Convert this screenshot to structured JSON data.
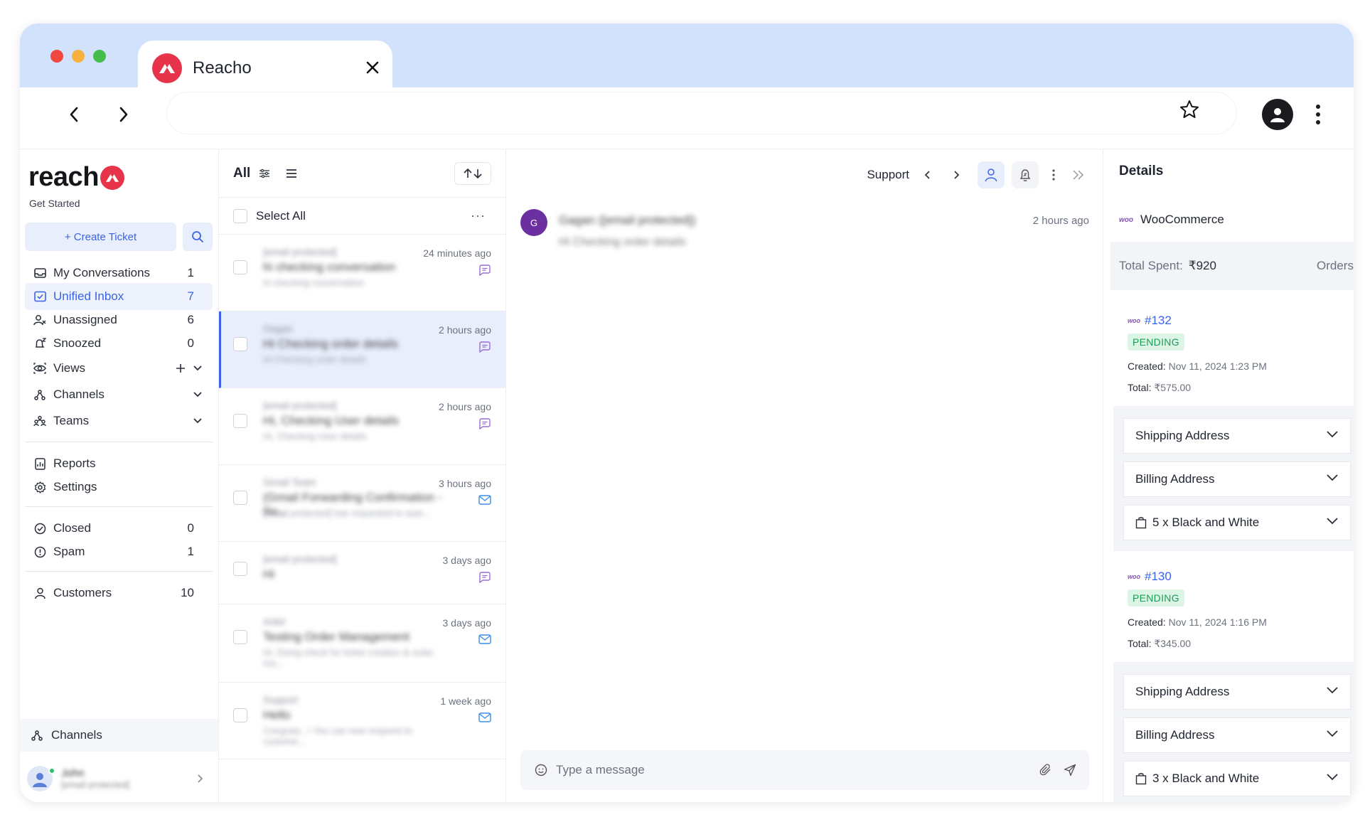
{
  "browser": {
    "tab_title": "Reacho",
    "url": ""
  },
  "colors": {
    "accent": "#3b63e5",
    "brand": "#e8344a",
    "chrome": "#d3e2fc",
    "pending_bg": "#ddf5e7",
    "pending_text": "#1a9d54"
  },
  "sidebar": {
    "brand": "reach",
    "get_started": "Get Started",
    "create_ticket": "+ Create Ticket",
    "items": [
      {
        "label": "My Conversations",
        "count": "1",
        "icon": "inbox-icon"
      },
      {
        "label": "Unified Inbox",
        "count": "7",
        "icon": "unified-inbox-icon"
      },
      {
        "label": "Unassigned",
        "count": "6",
        "icon": "unassigned-icon"
      },
      {
        "label": "Snoozed",
        "count": "0",
        "icon": "snooze-icon"
      },
      {
        "label": "Views",
        "count": "",
        "icon": "views-icon"
      },
      {
        "label": "Channels",
        "count": "",
        "icon": "channels-icon"
      },
      {
        "label": "Teams",
        "count": "",
        "icon": "teams-icon"
      },
      {
        "label": "Reports",
        "count": "",
        "icon": "reports-icon"
      },
      {
        "label": "Settings",
        "count": "",
        "icon": "settings-icon"
      },
      {
        "label": "Closed",
        "count": "0",
        "icon": "closed-icon"
      },
      {
        "label": "Spam",
        "count": "1",
        "icon": "spam-icon"
      },
      {
        "label": "Customers",
        "count": "10",
        "icon": "customers-icon"
      }
    ],
    "bottom_channels": "Channels",
    "user": {
      "name": "John",
      "email": "[email protected]"
    }
  },
  "list": {
    "filter": "All",
    "select_all": "Select All",
    "more": "···",
    "conversations": [
      {
        "from": "[email protected]",
        "subject": "hi checking conversation",
        "preview": "hi checking conversation",
        "time": "24 minutes ago",
        "channel": "chat"
      },
      {
        "from": "Gagan",
        "subject": "Hi Checking order details",
        "preview": "Hi Checking order details",
        "time": "2 hours ago",
        "channel": "chat"
      },
      {
        "from": "[email protected]",
        "subject": "Hi, Checking User details",
        "preview": "Hi, Checking User details",
        "time": "2 hours ago",
        "channel": "chat"
      },
      {
        "from": "Gmail Team",
        "subject": "(Gmail Forwarding Confirmation - Re...",
        "preview": "[email protected] has requested to auto...",
        "time": "3 hours ago",
        "channel": "email"
      },
      {
        "from": "[email protected]",
        "subject": "Hi",
        "preview": "",
        "time": "3 days ago",
        "channel": "chat"
      },
      {
        "from": "Ankit",
        "subject": "Testing Order Management",
        "preview": "Hi, Doing check for ticket creation & order ma...",
        "time": "3 days ago",
        "channel": "email"
      },
      {
        "from": "Support",
        "subject": "Hello",
        "preview": "Congrats...! You can now respond to custome...",
        "time": "1 week ago",
        "channel": "email"
      }
    ]
  },
  "conversation": {
    "team": "Support",
    "avatar_initial": "G",
    "from": "Gagan ([email protected])",
    "message": "Hi Checking order details",
    "time": "2 hours ago",
    "composer_placeholder": "Type a message"
  },
  "details": {
    "title": "Details",
    "integration": "WooCommerce",
    "woo_logo": "woo",
    "total_spent_label": "Total Spent:",
    "total_spent_value": "₹920",
    "orders_label": "Orders:",
    "orders": [
      {
        "id": "#132",
        "status": "PENDING",
        "created_label": "Created:",
        "created": "Nov 11, 2024 1:23 PM",
        "total_label": "Total:",
        "total": "₹575.00",
        "shipping": "Shipping Address",
        "billing": "Billing Address",
        "items": "5 x Black and White"
      },
      {
        "id": "#130",
        "status": "PENDING",
        "created_label": "Created:",
        "created": "Nov 11, 2024 1:16 PM",
        "total_label": "Total:",
        "total": "₹345.00",
        "shipping": "Shipping Address",
        "billing": "Billing Address",
        "items": "3 x Black and White"
      }
    ]
  }
}
